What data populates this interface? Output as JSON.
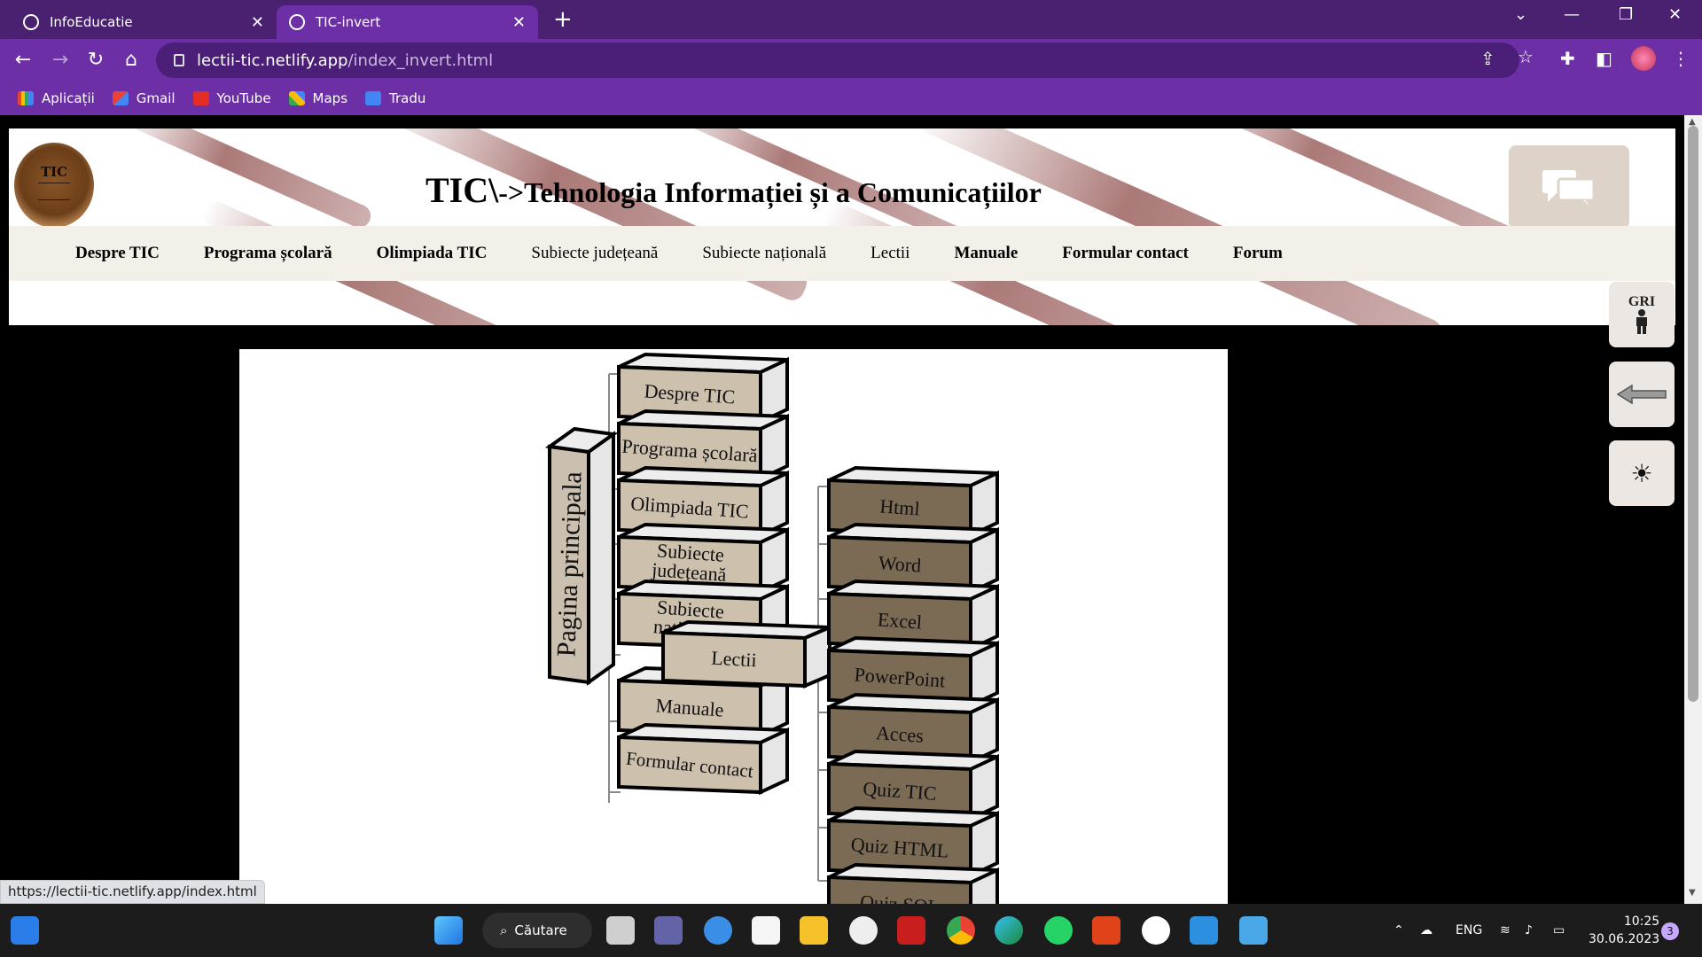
{
  "browser": {
    "tabs": [
      {
        "title": "InfoEducatie",
        "active": false
      },
      {
        "title": "TIC-invert",
        "active": true
      }
    ],
    "url_host": "lectii-tic.netlify.app",
    "url_path": "/index_invert.html",
    "bookmarks": [
      "Aplicații",
      "Gmail",
      "YouTube",
      "Maps",
      "Tradu"
    ],
    "status_url": "https://lectii-tic.netlify.app/index.html"
  },
  "site": {
    "logo_text": "TIC",
    "title_big": "TIC\\",
    "title_arrow": "->",
    "title_rest": "Tehnologia Informației și a Comunicațiilor",
    "menu": [
      {
        "label": "Despre TIC",
        "bold": true
      },
      {
        "label": "Programa școlară",
        "bold": true
      },
      {
        "label": "Olimpiada TIC",
        "bold": true
      },
      {
        "label": "Subiecte județeană",
        "bold": false
      },
      {
        "label": "Subiecte națională",
        "bold": false
      },
      {
        "label": "Lectii",
        "bold": false
      },
      {
        "label": "Manuale",
        "bold": true
      },
      {
        "label": "Formular contact",
        "bold": true
      },
      {
        "label": "Forum",
        "bold": true
      }
    ],
    "side_gri": "GRI"
  },
  "diagram": {
    "main_block": "Pagina principala",
    "left_column": [
      {
        "label": "Despre TIC"
      },
      {
        "label": "Programa școlară"
      },
      {
        "label": "Olimpiada TIC"
      },
      {
        "label": "Subiecte",
        "label2": "județeană"
      },
      {
        "label": "Subiecte",
        "label2": "națională"
      },
      {
        "label": "Manuale"
      },
      {
        "label": "Formular contact"
      }
    ],
    "lectii_block": "Lectii",
    "right_column": [
      "Html",
      "Word",
      "Excel",
      "PowerPoint",
      "Acces",
      "Quiz TIC",
      "Quiz HTML",
      "Quiz SQL"
    ]
  },
  "taskbar": {
    "search_label": "Căutare",
    "lang": "ENG",
    "time": "10:25",
    "date": "30.06.2023",
    "notifications": "3"
  }
}
